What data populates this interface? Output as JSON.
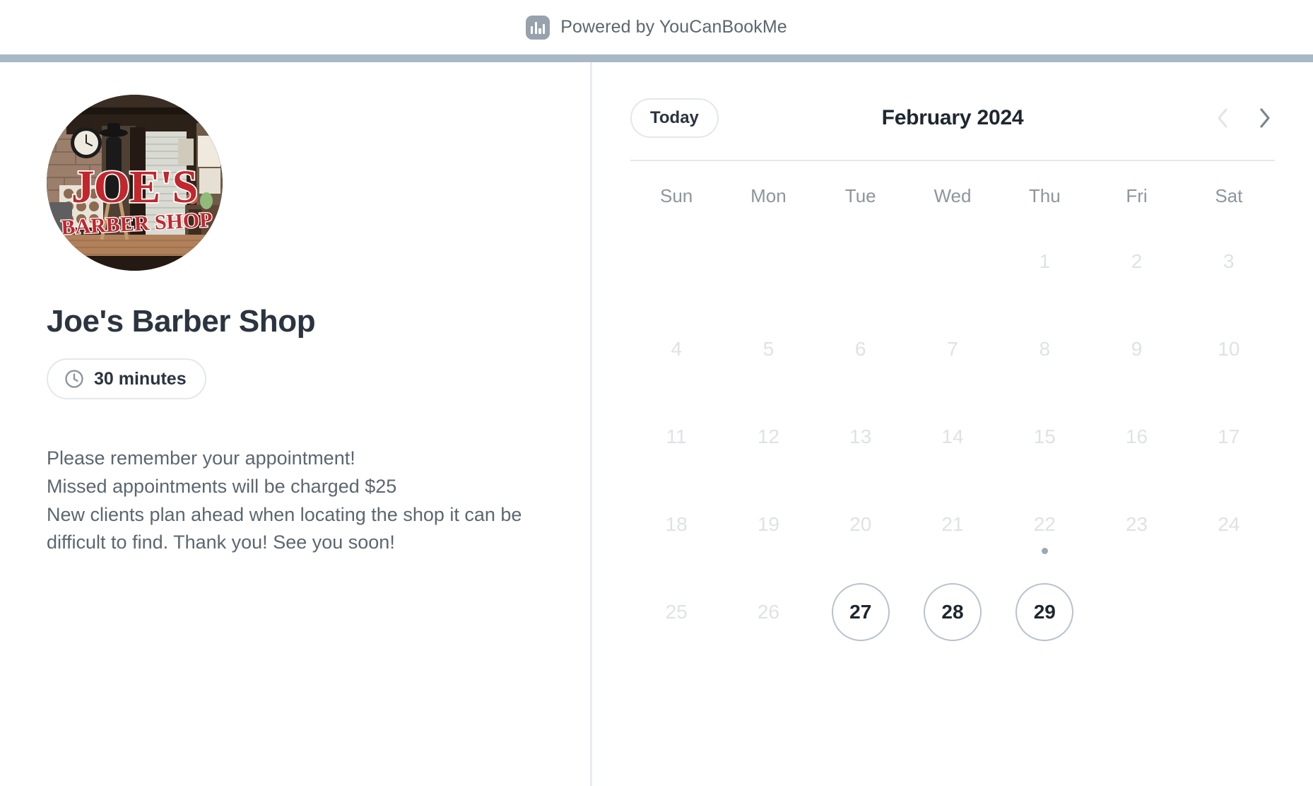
{
  "colors": {
    "accent_band": "#a9b7c6",
    "title_text": "#2b3440",
    "body_text": "#5c6670",
    "disabled_day": "#dfe2e5",
    "available_day_border": "#b8c2cf",
    "today_dot": "#9aa8b8",
    "logo_bg": "#98a2ad"
  },
  "powered_by": {
    "icon": "ycbm-bars-logo-icon",
    "text": "Powered by YouCanBookMe"
  },
  "profile": {
    "avatar_alt": "Joe's Barber Shop storefront sign photo",
    "avatar_sign_line1": "JOE'S",
    "avatar_sign_line2": "BARBER SHOP",
    "title": "Joe's Barber Shop",
    "duration_icon": "clock-icon",
    "duration": "30 minutes",
    "description": "Please remember your appointment!\nMissed appointments will be charged $25\nNew clients plan ahead when locating the shop it can be difficult to find. Thank you! See you soon!"
  },
  "calendar": {
    "today_label": "Today",
    "month_label": "February 2024",
    "prev_icon": "chevron-left-icon",
    "next_icon": "chevron-right-icon",
    "prev_enabled": false,
    "next_enabled": true,
    "weekdays": [
      "Sun",
      "Mon",
      "Tue",
      "Wed",
      "Thu",
      "Fri",
      "Sat"
    ],
    "weeks": [
      [
        {
          "day": "",
          "state": "empty"
        },
        {
          "day": "",
          "state": "empty"
        },
        {
          "day": "",
          "state": "empty"
        },
        {
          "day": "",
          "state": "empty"
        },
        {
          "day": "1",
          "state": "disabled"
        },
        {
          "day": "2",
          "state": "disabled"
        },
        {
          "day": "3",
          "state": "disabled"
        }
      ],
      [
        {
          "day": "4",
          "state": "disabled"
        },
        {
          "day": "5",
          "state": "disabled"
        },
        {
          "day": "6",
          "state": "disabled"
        },
        {
          "day": "7",
          "state": "disabled"
        },
        {
          "day": "8",
          "state": "disabled"
        },
        {
          "day": "9",
          "state": "disabled"
        },
        {
          "day": "10",
          "state": "disabled"
        }
      ],
      [
        {
          "day": "11",
          "state": "disabled"
        },
        {
          "day": "12",
          "state": "disabled"
        },
        {
          "day": "13",
          "state": "disabled"
        },
        {
          "day": "14",
          "state": "disabled"
        },
        {
          "day": "15",
          "state": "disabled"
        },
        {
          "day": "16",
          "state": "disabled"
        },
        {
          "day": "17",
          "state": "disabled"
        }
      ],
      [
        {
          "day": "18",
          "state": "disabled"
        },
        {
          "day": "19",
          "state": "disabled"
        },
        {
          "day": "20",
          "state": "disabled"
        },
        {
          "day": "21",
          "state": "disabled"
        },
        {
          "day": "22",
          "state": "disabled",
          "is_today": true
        },
        {
          "day": "23",
          "state": "disabled"
        },
        {
          "day": "24",
          "state": "disabled"
        }
      ],
      [
        {
          "day": "25",
          "state": "disabled"
        },
        {
          "day": "26",
          "state": "disabled"
        },
        {
          "day": "27",
          "state": "available"
        },
        {
          "day": "28",
          "state": "available"
        },
        {
          "day": "29",
          "state": "available"
        },
        {
          "day": "",
          "state": "empty"
        },
        {
          "day": "",
          "state": "empty"
        }
      ]
    ]
  }
}
